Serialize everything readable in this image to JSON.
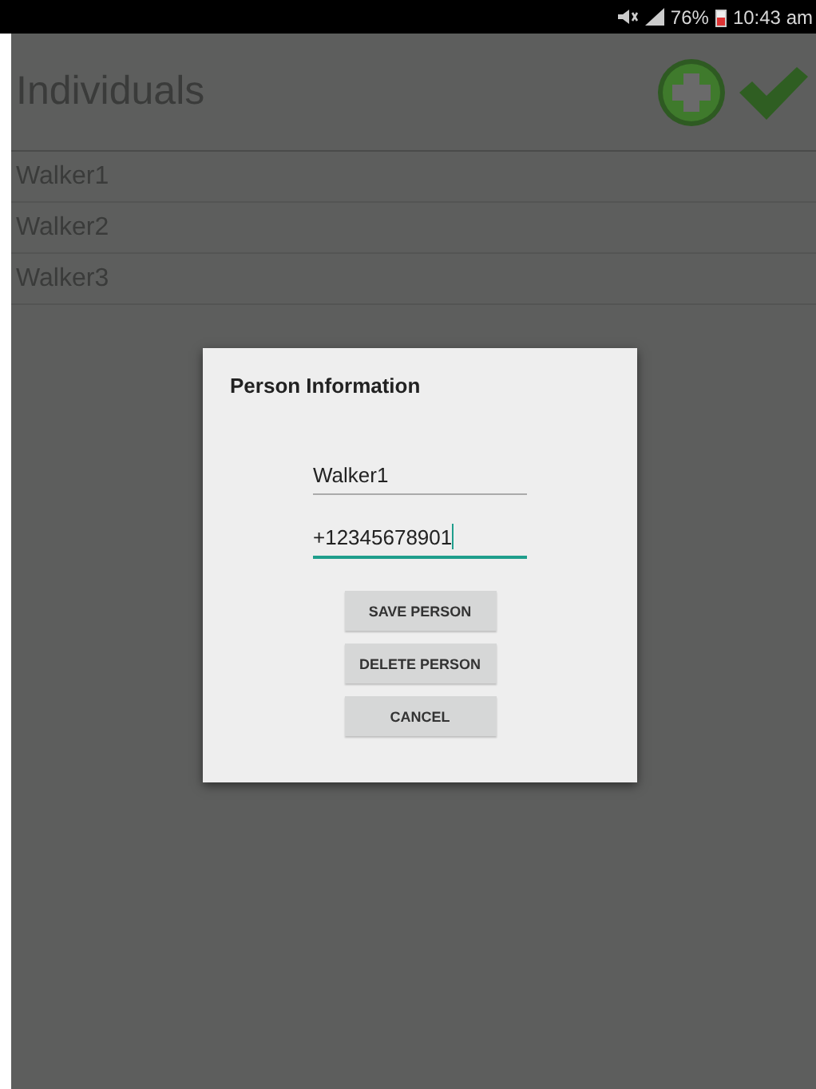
{
  "status_bar": {
    "battery": "76%",
    "time": "10:43 am"
  },
  "title": "Individuals",
  "list": [
    "Walker1",
    "Walker2",
    "Walker3"
  ],
  "dialog": {
    "title": "Person Information",
    "fields": [
      {
        "value": "Walker1",
        "focused": false
      },
      {
        "value": "+12345678901",
        "focused": true
      }
    ],
    "buttons": [
      "SAVE PERSON",
      "DELETE PERSON",
      "CANCEL"
    ]
  }
}
